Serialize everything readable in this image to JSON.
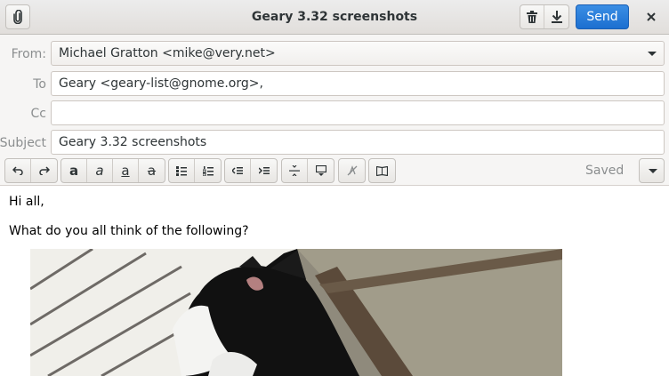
{
  "window": {
    "title": "Geary 3.32 screenshots"
  },
  "titlebar": {
    "attach_icon": "paperclip-icon",
    "delete_icon": "trash-icon",
    "save_icon": "download-icon",
    "send_label": "Send",
    "close_icon": "close-icon"
  },
  "headers": {
    "from_label": "From:",
    "from_value": "Michael Gratton <mike@very.net>",
    "to_label": "To",
    "to_value": "Geary <geary-list@gnome.org>,",
    "cc_label": "Cc",
    "cc_value": "",
    "subject_label": "Subject",
    "subject_value": "Geary 3.32 screenshots"
  },
  "toolbar": {
    "status": "Saved",
    "icons": [
      "undo-icon",
      "redo-icon",
      "bold-icon",
      "italic-icon",
      "underline-icon",
      "strikethrough-icon",
      "bullet-list-icon",
      "numbered-list-icon",
      "outdent-icon",
      "indent-icon",
      "remove-format-icon",
      "insert-image-icon",
      "clear-formatting-icon",
      "dictionary-icon",
      "more-options-icon"
    ]
  },
  "message": {
    "greeting": "Hi all,",
    "line1": "What do you all think of the following?",
    "image_subject": "black-and-white-cat-photo"
  }
}
